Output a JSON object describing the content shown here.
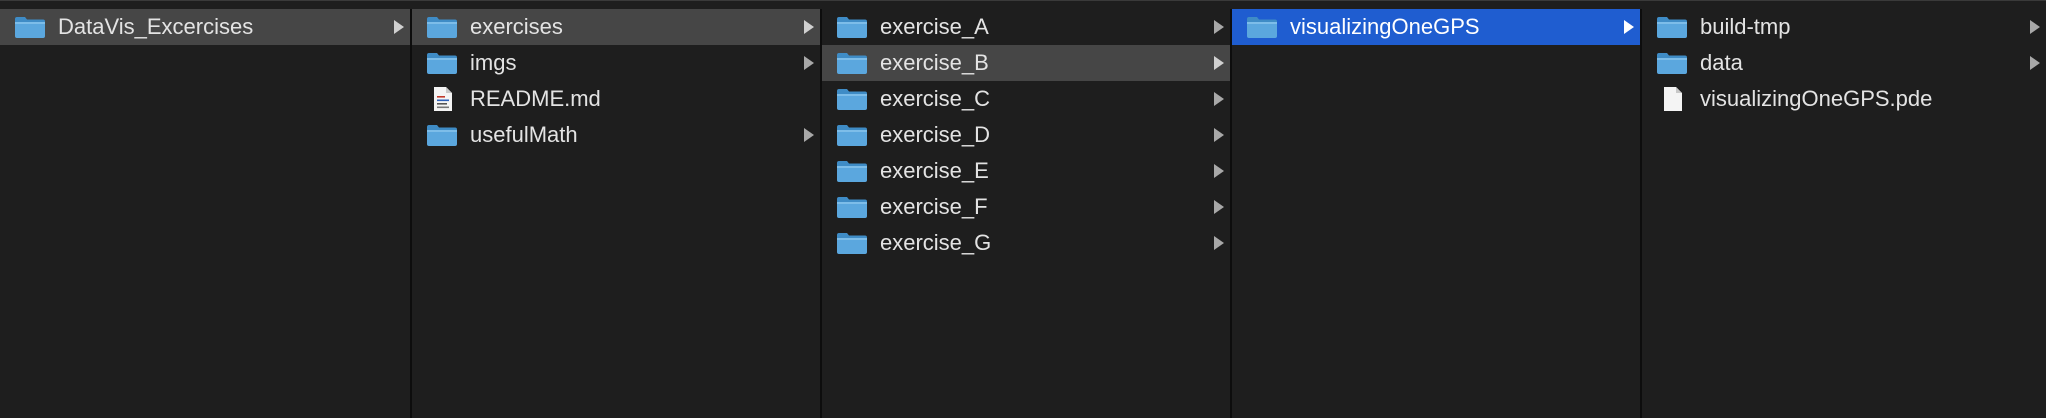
{
  "colors": {
    "background": "#1e1e1e",
    "selection_active": "#1f5dd0",
    "selection_inactive": "#464646",
    "text": "#e3e3e3",
    "folder_icon": "#4a9fd8"
  },
  "columns": [
    {
      "items": [
        {
          "label": "DataVis_Excercises",
          "icon": "folder-icon",
          "has_children": true,
          "selected": "inactive"
        }
      ]
    },
    {
      "items": [
        {
          "label": "exercises",
          "icon": "folder-icon",
          "has_children": true,
          "selected": "inactive"
        },
        {
          "label": "imgs",
          "icon": "folder-icon",
          "has_children": true,
          "selected": "none"
        },
        {
          "label": "README.md",
          "icon": "markdown-file-icon",
          "has_children": false,
          "selected": "none"
        },
        {
          "label": "usefulMath",
          "icon": "folder-icon",
          "has_children": true,
          "selected": "none"
        }
      ]
    },
    {
      "items": [
        {
          "label": "exercise_A",
          "icon": "folder-icon",
          "has_children": true,
          "selected": "none"
        },
        {
          "label": "exercise_B",
          "icon": "folder-icon",
          "has_children": true,
          "selected": "inactive"
        },
        {
          "label": "exercise_C",
          "icon": "folder-icon",
          "has_children": true,
          "selected": "none"
        },
        {
          "label": "exercise_D",
          "icon": "folder-icon",
          "has_children": true,
          "selected": "none"
        },
        {
          "label": "exercise_E",
          "icon": "folder-icon",
          "has_children": true,
          "selected": "none"
        },
        {
          "label": "exercise_F",
          "icon": "folder-icon",
          "has_children": true,
          "selected": "none"
        },
        {
          "label": "exercise_G",
          "icon": "folder-icon",
          "has_children": true,
          "selected": "none"
        }
      ]
    },
    {
      "items": [
        {
          "label": "visualizingOneGPS",
          "icon": "folder-icon",
          "has_children": true,
          "selected": "active"
        }
      ]
    },
    {
      "items": [
        {
          "label": "build-tmp",
          "icon": "folder-icon",
          "has_children": true,
          "selected": "none"
        },
        {
          "label": "data",
          "icon": "folder-icon",
          "has_children": true,
          "selected": "none"
        },
        {
          "label": "visualizingOneGPS.pde",
          "icon": "file-icon",
          "has_children": false,
          "selected": "none"
        }
      ]
    }
  ]
}
